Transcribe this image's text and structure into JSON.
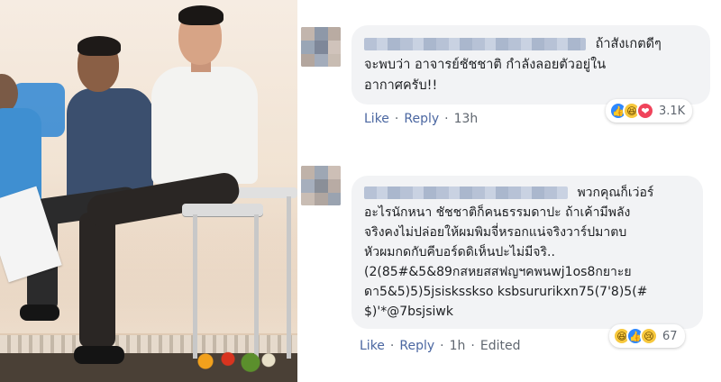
{
  "comments": [
    {
      "text_lines": [
        "ถ้าสังเกตดีๆ",
        "จะพบว่า อาจารย์ชัชชาติ กำลังลอยตัวอยู่ใน",
        "อากาศครับ!!"
      ],
      "actions": {
        "like": "Like",
        "reply": "Reply",
        "time": "13h"
      },
      "reactions": {
        "icons": [
          "like-icon",
          "haha-icon",
          "love-icon"
        ],
        "count": "3.1K"
      }
    },
    {
      "text_lines": [
        "พวกคุณก็เว่อร์",
        "อะไรนักหนา ชัชชาติก็คนธรรมดาปะ ถ้าเค้ามีพลัง",
        "จริงคงไม่ปล่อยให้ผมพิมจี่หรอกแน่จริงวาร์ปมาตบ",
        "หัวผมกดกับคีบอร์ดดิเห็นปะไม่มีจริ..",
        "(2(85#&5&89กสหยสสฟญฯคพนwj1os8กยาะย",
        "ดา5&5)5)5jsisksskso ksbsururikxn75(7'8)5(#",
        "$)'*@7bsjsiwk"
      ],
      "actions": {
        "like": "Like",
        "reply": "Reply",
        "time": "1h",
        "edited": "Edited"
      },
      "reactions": {
        "icons": [
          "haha-icon",
          "like-icon",
          "sad-icon"
        ],
        "count": "67"
      }
    }
  ],
  "colors": {
    "link": "#4b67a1",
    "bubble": "#f2f3f5",
    "meta": "#606770",
    "like": "#2d88ff",
    "love": "#f0445b"
  }
}
